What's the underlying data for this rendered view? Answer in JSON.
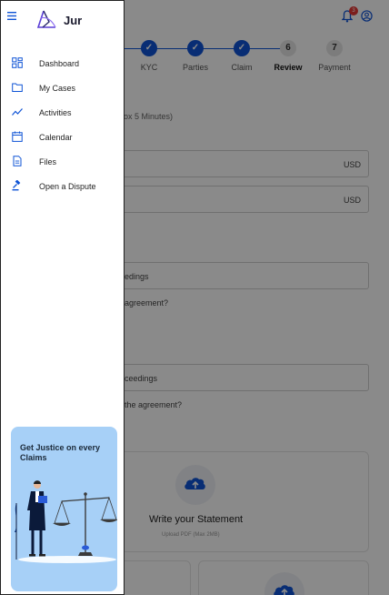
{
  "app": {
    "brand_name": "Jur"
  },
  "topbar": {
    "notifications_count": "3"
  },
  "stepper": {
    "steps": [
      {
        "label": "KYC",
        "status": "done",
        "mark": "✓"
      },
      {
        "label": "Parties",
        "status": "done",
        "mark": "✓"
      },
      {
        "label": "Claim",
        "status": "done",
        "mark": "✓"
      },
      {
        "label": "Review",
        "status": "active",
        "mark": "6"
      },
      {
        "label": "Payment",
        "status": "todo",
        "mark": "7"
      }
    ]
  },
  "form": {
    "hint": "ox 5 Minutes)",
    "amount_currency_1": "USD",
    "amount_currency_2": "USD",
    "field_1": "edings",
    "question_1": "agreement?",
    "field_2": "ceedings",
    "question_2": "the agreement?"
  },
  "upload": {
    "title": "Write your Statement",
    "subtitle": "Upload PDF (Max 2MB)"
  },
  "drawer": {
    "nav_items": [
      {
        "label": "Dashboard",
        "icon": "dashboard-icon"
      },
      {
        "label": "My Cases",
        "icon": "folder-icon"
      },
      {
        "label": "Activities",
        "icon": "activity-trend-icon"
      },
      {
        "label": "Calendar",
        "icon": "calendar-icon"
      },
      {
        "label": "Files",
        "icon": "file-icon"
      },
      {
        "label": "Open a Dispute",
        "icon": "gavel-icon"
      }
    ],
    "promo_text": "Get Justice on every Claims"
  },
  "colors": {
    "accent": "#0f54d6",
    "promo_bg": "#a7d0f7",
    "brand_purple": "#5b3fd6"
  }
}
